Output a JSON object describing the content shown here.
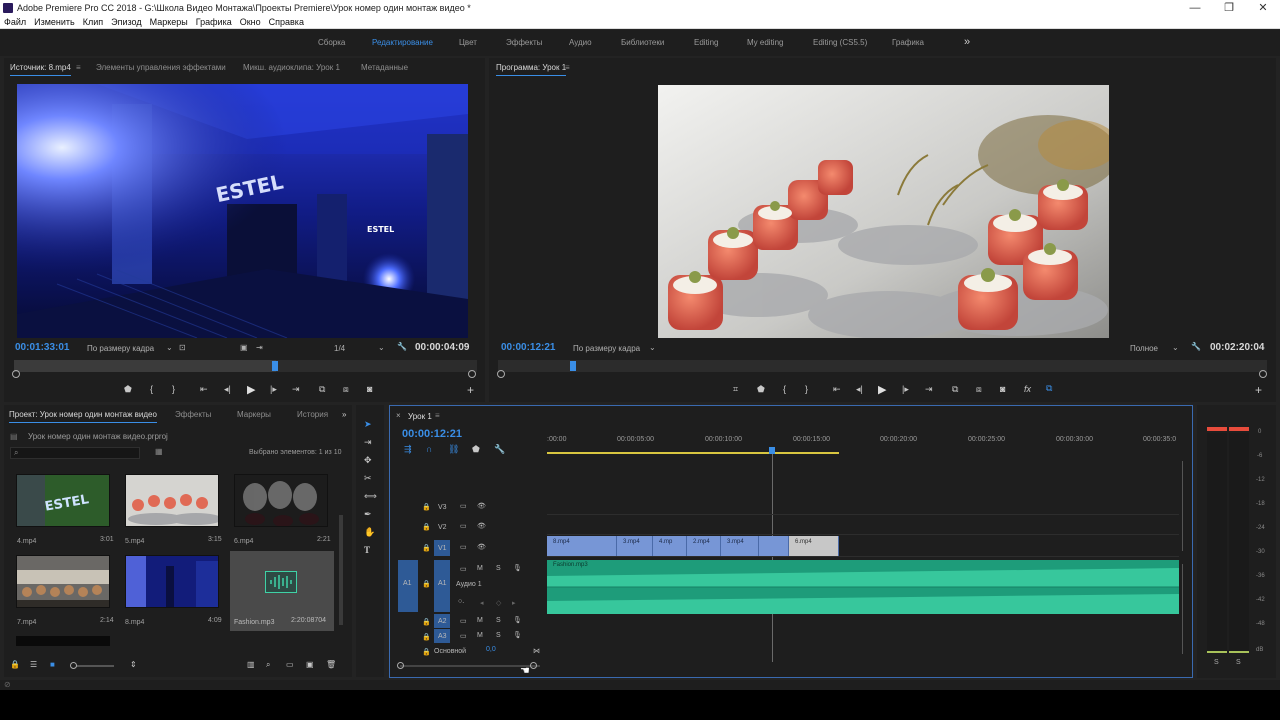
{
  "app": {
    "title": "Adobe Premiere Pro CC 2018 - G:\\Школа Видео Монтажа\\Проекты Premiere\\Урок номер один монтаж видео *"
  },
  "menu": [
    "Файл",
    "Изменить",
    "Клип",
    "Эпизод",
    "Маркеры",
    "Графика",
    "Окно",
    "Справка"
  ],
  "workspaces": {
    "items": [
      "Сборка",
      "Редактирование",
      "Цвет",
      "Эффекты",
      "Аудио",
      "Библиотеки",
      "Editing",
      "My editing",
      "Editing (CS5.5)",
      "Графика"
    ],
    "active": "Редактирование",
    "more": "»"
  },
  "source_panel": {
    "tabs": [
      "Источник: 8.mp4",
      "Элементы управления эффектами",
      "Микш. аудиоклипа: Урок 1",
      "Метаданные"
    ],
    "timecode": "00:01:33:01",
    "fit": "По размеру кадра",
    "resolution": "1/4",
    "duration": "00:00:04:09"
  },
  "program_panel": {
    "tab": "Программа: Урок 1",
    "timecode": "00:00:12:21",
    "fit": "По размеру кадра",
    "quality": "Полное",
    "duration": "00:02:20:04"
  },
  "project_panel": {
    "tabs": [
      "Проект: Урок номер один монтаж видео",
      "Эффекты",
      "Маркеры",
      "История"
    ],
    "more": "»",
    "file": "Урок номер один монтаж видео.prproj",
    "selection": "Выбрано элементов: 1 из 10",
    "items": [
      {
        "name": "4.mp4",
        "duration": "3:01"
      },
      {
        "name": "5.mp4",
        "duration": "3:15"
      },
      {
        "name": "6.mp4",
        "duration": "2:21"
      },
      {
        "name": "7.mp4",
        "duration": "2:14"
      },
      {
        "name": "8.mp4",
        "duration": "4:09"
      },
      {
        "name": "Fashion.mp3",
        "duration": "2:20:08704"
      }
    ]
  },
  "timeline": {
    "tab": "Урок 1",
    "timecode": "00:00:12:21",
    "ruler": [
      ":00:00",
      "00:00:05:00",
      "00:00:10:00",
      "00:00:15:00",
      "00:00:20:00",
      "00:00:25:00",
      "00:00:30:00",
      "00:00:35:0"
    ],
    "video_tracks": [
      "V3",
      "V2",
      "V1"
    ],
    "audio_tracks": [
      "A1",
      "A2",
      "A3"
    ],
    "audio1_name": "Аудио 1",
    "master_label": "Основной",
    "master_value": "0,0",
    "clips": [
      "8.mp4",
      "3.mp4",
      "4.mp",
      "2.mp4",
      "3.mp4",
      "",
      "6.mp4"
    ],
    "audio_clip": "Fashion.mp3"
  },
  "meter": {
    "scale": [
      "0",
      "-6",
      "-12",
      "-18",
      "-24",
      "-30",
      "-36",
      "-42",
      "-48",
      "dB"
    ],
    "solo_left": "S",
    "solo_right": "S"
  }
}
